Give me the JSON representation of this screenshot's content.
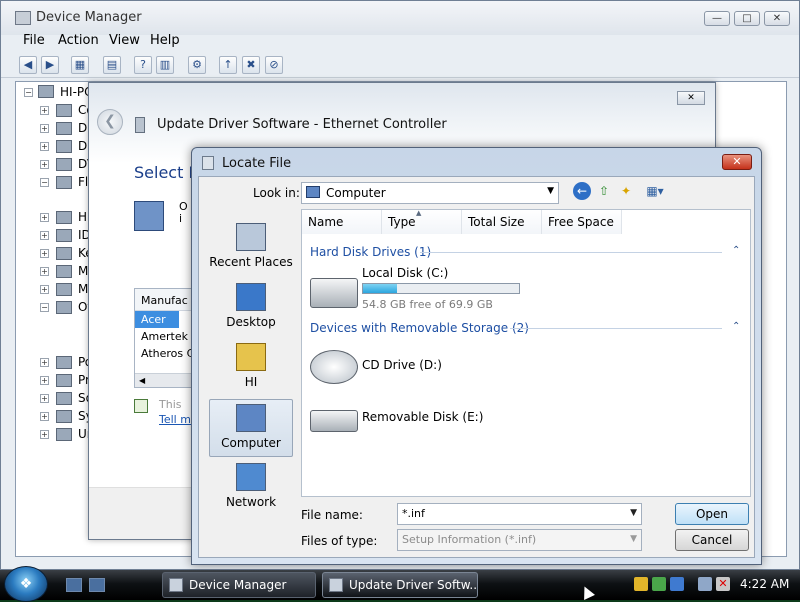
{
  "device_manager": {
    "title": "Device Manager",
    "menu": [
      "File",
      "Action",
      "View",
      "Help"
    ],
    "tree_root": "HI-PC",
    "tree_items": [
      "Co",
      "Di",
      "Di",
      "DV",
      "Fl",
      "Hu",
      "ID",
      "Ke",
      "Mi",
      "Mi",
      "Ot",
      "Po",
      "Pr",
      "So",
      "Sy",
      "Ur"
    ]
  },
  "wizard": {
    "title": "Update Driver Software - Ethernet Controller",
    "heading": "Select N",
    "line_fragment": "O\ni",
    "manufacturer_header": "Manufac",
    "manufacturers": [
      "Acer",
      "Amertek",
      "Atheros C"
    ],
    "this_text": "This",
    "tell_text": "Tell m"
  },
  "locate_file": {
    "title": "Locate File",
    "look_in_label": "Look in:",
    "look_in_value": "Computer",
    "places": [
      "Recent Places",
      "Desktop",
      "HI",
      "Computer",
      "Network"
    ],
    "columns": [
      "Name",
      "Type",
      "Total Size",
      "Free Space"
    ],
    "groups": {
      "hard": "Hard Disk Drives (1)",
      "removable": "Devices with Removable Storage (2)"
    },
    "drives": {
      "local_name": "Local Disk (C:)",
      "local_free": "54.8 GB free of 69.9 GB",
      "local_used_fraction": 0.22,
      "cd_name": "CD Drive (D:)",
      "removable_name": "Removable Disk (E:)"
    },
    "file_name_label": "File name:",
    "file_name_value": "*.inf",
    "file_type_label": "Files of type:",
    "file_type_value": "Setup Information (*.inf)",
    "open_label": "Open",
    "cancel_label": "Cancel"
  },
  "taskbar": {
    "tasks": [
      "Device Manager",
      "Update Driver Softw..."
    ],
    "clock": "4:22 AM"
  }
}
